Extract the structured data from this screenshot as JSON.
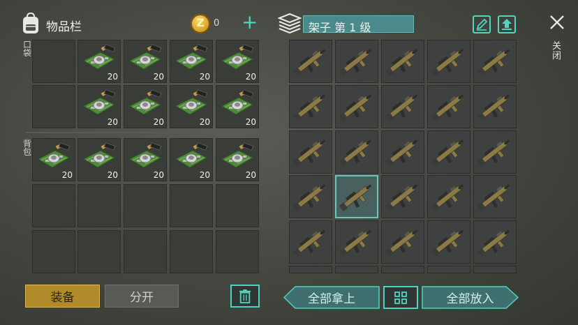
{
  "inventory": {
    "title": "物品栏",
    "coins": "0",
    "pocket_label": "口袋",
    "backpack_label": "背包",
    "item_name": "circuit-board-item",
    "pocket_rows": [
      [
        "",
        "20",
        "20",
        "20",
        "20"
      ],
      [
        "",
        "20",
        "20",
        "20",
        "20"
      ]
    ],
    "backpack_rows": [
      [
        "20",
        "20",
        "20",
        "20",
        "20"
      ],
      [
        "",
        "",
        "",
        "",
        ""
      ],
      [
        "",
        "",
        "",
        "",
        ""
      ]
    ]
  },
  "shelf": {
    "title": "架子 第 1 级",
    "item_name": "assault-rifle-item",
    "selected": [
      3,
      1
    ]
  },
  "close_label": "关闭",
  "buttons": {
    "equip": "装备",
    "split": "分开",
    "take_all": "全部拿上",
    "put_all": "全部放入"
  },
  "colors": {
    "accent": "#4fd3c0",
    "equip": "#b18a2c",
    "shelf_title_bg": "#4a8a8c"
  }
}
